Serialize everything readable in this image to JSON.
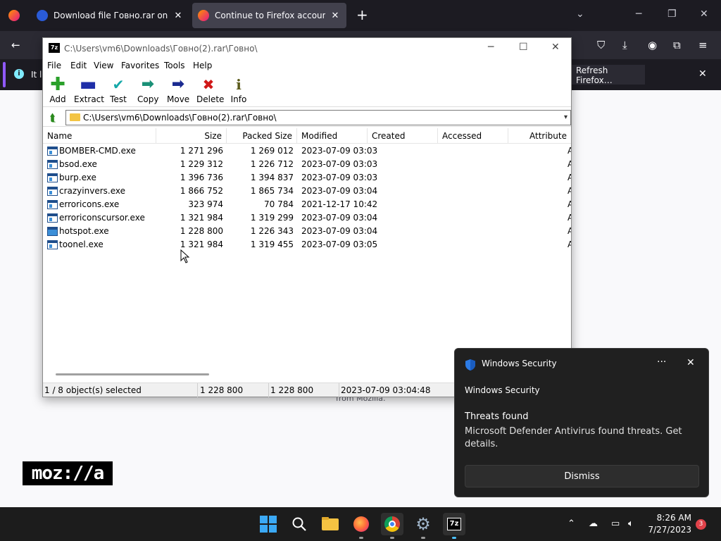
{
  "browser": {
    "tabs": [
      {
        "title": "Download file Говно.rar on Ox"
      },
      {
        "title": "Continue to Firefox accounts"
      }
    ],
    "new_tab": "+",
    "infobar": {
      "text": "It lo",
      "refresh_label": "Refresh Firefox…"
    }
  },
  "page": {
    "card_text": "from Mozilla.",
    "logo_text": "moz://a"
  },
  "sevenzip": {
    "title": "C:\\Users\\vm6\\Downloads\\Говно(2).rar\\Говно\\",
    "logo": "7z",
    "menu": [
      "File",
      "Edit",
      "View",
      "Favorites",
      "Tools",
      "Help"
    ],
    "toolbar": [
      "Add",
      "Extract",
      "Test",
      "Copy",
      "Move",
      "Delete",
      "Info"
    ],
    "address": "C:\\Users\\vm6\\Downloads\\Говно(2).rar\\Говно\\",
    "columns": [
      "Name",
      "Size",
      "Packed Size",
      "Modified",
      "Created",
      "Accessed",
      "Attribute"
    ],
    "files": [
      {
        "name": "BOMBER-CMD.exe",
        "size": "1 271 296",
        "packed": "1 269 012",
        "modified": "2023-07-09 03:03",
        "attr": "A"
      },
      {
        "name": "bsod.exe",
        "size": "1 229 312",
        "packed": "1 226 712",
        "modified": "2023-07-09 03:03",
        "attr": "A"
      },
      {
        "name": "burp.exe",
        "size": "1 396 736",
        "packed": "1 394 837",
        "modified": "2023-07-09 03:03",
        "attr": "A"
      },
      {
        "name": "crazyinvers.exe",
        "size": "1 866 752",
        "packed": "1 865 734",
        "modified": "2023-07-09 03:04",
        "attr": "A"
      },
      {
        "name": "erroricons.exe",
        "size": "323 974",
        "packed": "70 784",
        "modified": "2021-12-17 10:42",
        "attr": "A"
      },
      {
        "name": "erroriconscursor.exe",
        "size": "1 321 984",
        "packed": "1 319 299",
        "modified": "2023-07-09 03:04",
        "attr": "A"
      },
      {
        "name": "hotspot.exe",
        "size": "1 228 800",
        "packed": "1 226 343",
        "modified": "2023-07-09 03:04",
        "attr": "A"
      },
      {
        "name": "toonel.exe",
        "size": "1 321 984",
        "packed": "1 319 455",
        "modified": "2023-07-09 03:05",
        "attr": "A"
      }
    ],
    "status": {
      "selection": "1 / 8 object(s) selected",
      "size": "1 228 800",
      "packed": "1 228 800",
      "modified": "2023-07-09 03:04:48"
    }
  },
  "toast": {
    "app": "Windows Security",
    "more": "···",
    "source": "Windows Security",
    "heading": "Threats found",
    "body": "Microsoft Defender Antivirus found threats. Get details.",
    "dismiss": "Dismiss"
  },
  "taskbar": {
    "time": "8:26 AM",
    "date": "7/27/2023",
    "notification_count": "3",
    "sevenzip_label": "7z"
  },
  "colors": {
    "firefox_dark": "#1c1b22",
    "accent_blue": "#3ba9f5",
    "toast_bg": "#202020"
  }
}
